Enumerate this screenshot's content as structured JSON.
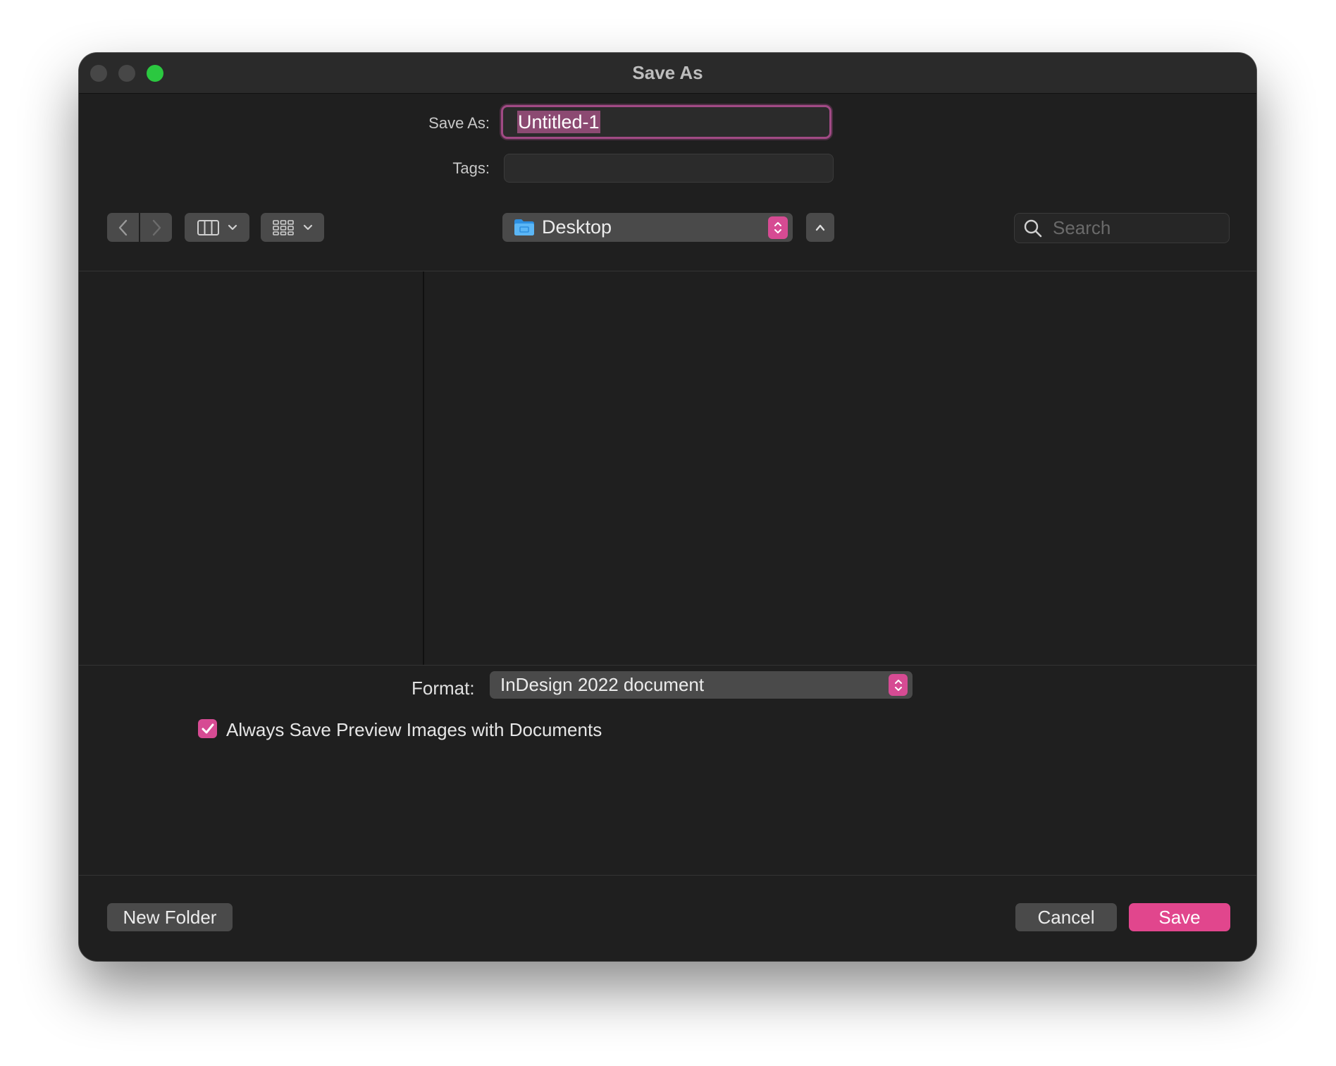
{
  "window": {
    "title": "Save As"
  },
  "form": {
    "save_as_label": "Save As:",
    "filename_value": "Untitled-1",
    "tags_label": "Tags:",
    "tags_value": ""
  },
  "toolbar": {
    "location_label": "Desktop",
    "search_placeholder": "Search"
  },
  "options": {
    "format_label": "Format:",
    "format_value": "InDesign 2022 document",
    "preview_checkbox_label": "Always Save Preview Images with Documents",
    "preview_checked": true
  },
  "buttons": {
    "new_folder": "New Folder",
    "cancel": "Cancel",
    "save": "Save"
  },
  "colors": {
    "accent": "#e1468d",
    "focus_ring": "#a14a85",
    "zoom_light": "#2bc840",
    "window_bg": "#1f1f1f"
  },
  "icons": {
    "back": "chevron-left-icon",
    "forward": "chevron-right-icon",
    "column_view": "columns-icon",
    "icon_view": "grid-icon",
    "location": "folder-icon",
    "collapse": "chevron-up-icon",
    "search": "search-icon",
    "checkbox": "checkmark-icon"
  }
}
